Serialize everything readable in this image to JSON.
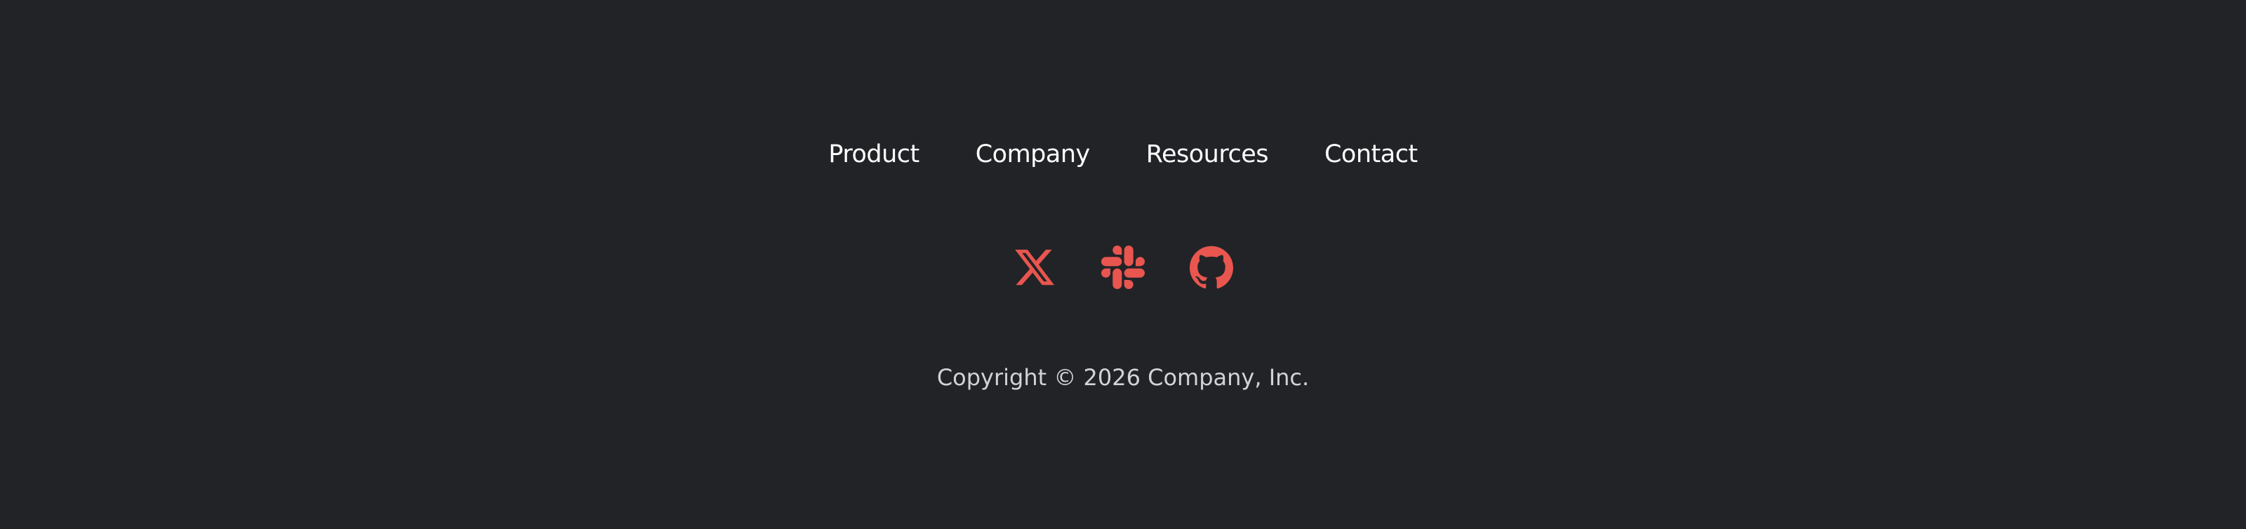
{
  "nav": {
    "items": [
      {
        "label": "Product"
      },
      {
        "label": "Company"
      },
      {
        "label": "Resources"
      },
      {
        "label": "Contact"
      }
    ]
  },
  "social": {
    "icons": [
      {
        "icon": "x-twitter-icon"
      },
      {
        "icon": "slack-icon"
      },
      {
        "icon": "github-icon"
      }
    ],
    "color": "#e8564f"
  },
  "footer": {
    "copyright": "Copyright © 2026 Company, Inc."
  },
  "colors": {
    "background": "#222327",
    "link_text": "#ffffff",
    "copyright_text": "#d2d3d6",
    "accent": "#e8564f"
  }
}
